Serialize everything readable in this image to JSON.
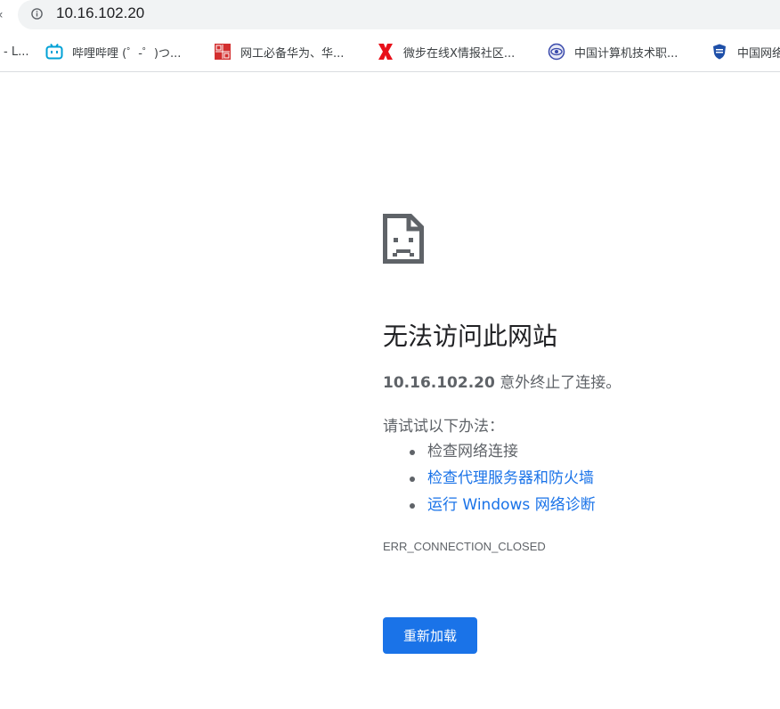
{
  "browser": {
    "url": "10.16.102.20",
    "bookmarks": [
      {
        "label": "- L...",
        "icon": "none"
      },
      {
        "label": "哔哩哔哩 (゜-゜)つ...",
        "icon": "bilibili-tv-icon"
      },
      {
        "label": "网工必备华为、华...",
        "icon": "red-seal-icon"
      },
      {
        "label": "微步在线X情报社区...",
        "icon": "red-x-icon"
      },
      {
        "label": "中国计算机技术职...",
        "icon": "eye-globe-icon"
      },
      {
        "label": "中国网络",
        "icon": "shield-emblem-icon"
      }
    ]
  },
  "error_page": {
    "title": "无法访问此网站",
    "summary_host": "10.16.102.20",
    "summary_rest": " 意外终止了连接。",
    "suggestions_heading": "请试试以下办法：",
    "suggestions": [
      {
        "text": "检查网络连接",
        "is_link": false
      },
      {
        "text": "检查代理服务器和防火墙",
        "is_link": true
      },
      {
        "text": "运行 Windows 网络诊断",
        "is_link": true
      }
    ],
    "error_code": "ERR_CONNECTION_CLOSED",
    "reload_label": "重新加载"
  },
  "colors": {
    "link": "#1a73e8",
    "button": "#1a73e8",
    "text": "#202124",
    "muted": "#5f6368"
  }
}
